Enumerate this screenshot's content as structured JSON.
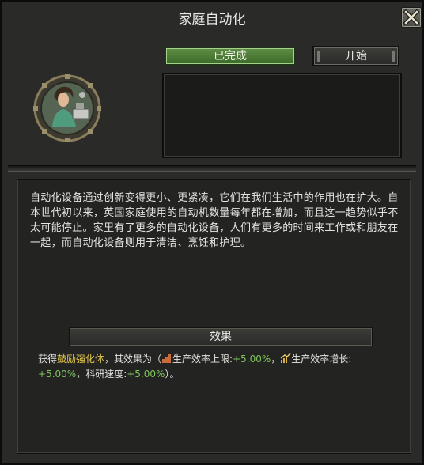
{
  "window": {
    "title": "家庭自动化"
  },
  "buttons": {
    "status": "已完成",
    "start": "开始"
  },
  "description": "自动化设备通过创新变得更小、更紧凑，它们在我们生活中的作用也在扩大。自本世代初以来，英国家庭使用的自动机数量每年都在增加，而且这一趋势似乎不太可能停止。家里有了更多的自动化设备，人们有更多的时间来工作或和朋友在一起，而自动化设备则用于清洁、烹饪和护理。",
  "effects": {
    "header": "效果",
    "prefix": "获得",
    "buff": "鼓励强化体",
    "mid": "，其效果为（",
    "stat1_label": "生产效率上限:",
    "stat1_value": "+5.00%",
    "sep1": "，",
    "stat2_label": "生产效率增长:",
    "stat2_value": "+5.00%",
    "sep2": "，",
    "stat3_label": "科研速度:",
    "stat3_value": "+5.00%",
    "suffix": "）。"
  },
  "icons": {
    "close": "close-icon",
    "portrait": "woman-portrait-icon",
    "stat1": "factory-chart-icon",
    "stat2": "growth-chart-icon"
  },
  "colors": {
    "accent_green": "#7fc65b",
    "highlight_gold": "#e1c64a",
    "status_button": "#4c7c36"
  }
}
